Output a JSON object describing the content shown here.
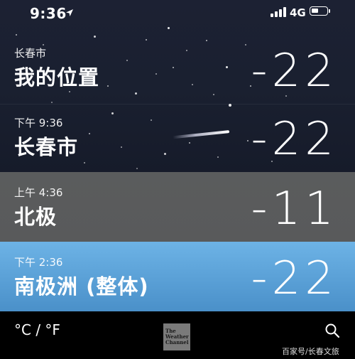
{
  "status_bar": {
    "time": "9:36",
    "network": "4G"
  },
  "cities": [
    {
      "subtitle": "长春市",
      "name": "我的位置",
      "temperature": "-22"
    },
    {
      "subtitle": "下午 9:36",
      "name": "长春市",
      "temperature": "-22"
    },
    {
      "subtitle": "上午 4:36",
      "name": "北极",
      "temperature": "-11"
    },
    {
      "subtitle": "下午 2:36",
      "name": "南极洲 (整体)",
      "temperature": "-22"
    }
  ],
  "toolbar": {
    "unit_toggle": "°C / °F",
    "logo_line1": "The",
    "logo_line2": "Weather",
    "logo_line3": "Channel"
  },
  "watermark": "百家号/长春文旅",
  "colors": {
    "night_background": "#1c2133",
    "arctic_card": "#5a5c5d",
    "antarctica_card": "#5ba3dc",
    "toolbar": "#000000"
  }
}
